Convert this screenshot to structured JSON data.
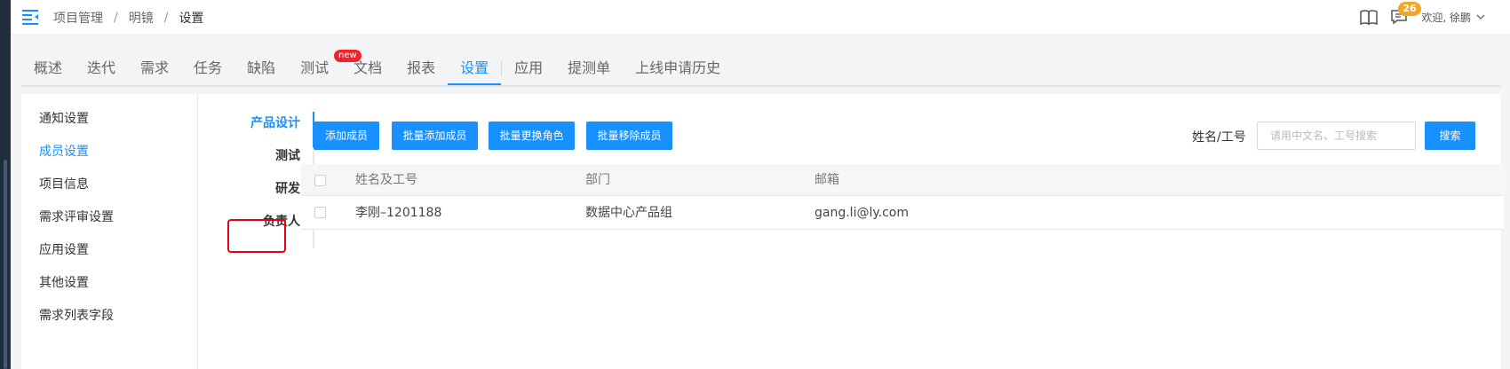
{
  "breadcrumb": [
    "项目管理",
    "明镜",
    "设置"
  ],
  "header": {
    "notification_count": "26",
    "welcome": "欢迎, 徐鹏"
  },
  "tabs": [
    "概述",
    "迭代",
    "需求",
    "任务",
    "缺陷",
    "测试",
    "文档",
    "报表",
    "设置",
    "应用",
    "提测单",
    "上线申请历史"
  ],
  "active_tab": "设置",
  "new_badge": "new",
  "sidebar": [
    "通知设置",
    "成员设置",
    "项目信息",
    "需求评审设置",
    "应用设置",
    "其他设置",
    "需求列表字段"
  ],
  "active_sidebar": "成员设置",
  "roles": [
    "产品设计",
    "测试",
    "研发",
    "负责人"
  ],
  "active_role": "产品设计",
  "toolbar": {
    "add": "添加成员",
    "batch_add": "批量添加成员",
    "batch_change_role": "批量更换角色",
    "batch_remove": "批量移除成员"
  },
  "search": {
    "label": "姓名/工号",
    "placeholder": "请用中文名、工号搜索",
    "button": "搜索"
  },
  "table": {
    "columns": [
      "姓名及工号",
      "部门",
      "邮箱"
    ],
    "rows": [
      [
        "李刚–1201188",
        "数据中心产品组",
        "gang.li@ly.com"
      ]
    ]
  },
  "colors": {
    "accent": "#1890ff",
    "badge": "#f5a623",
    "new_badge": "#f5222d",
    "highlight": "#e60012"
  }
}
